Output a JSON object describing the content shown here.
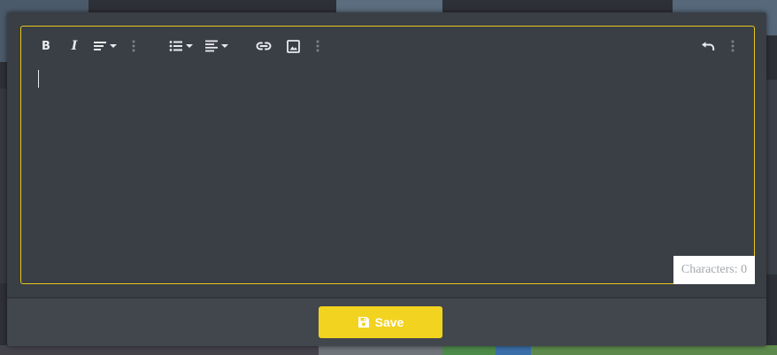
{
  "editor": {
    "toolbar": {
      "bold": {
        "label": "B",
        "icon": "bold-icon"
      },
      "italic": {
        "label": "I",
        "icon": "italic-icon"
      },
      "paragraph": {
        "icon": "text-format-icon"
      },
      "more_1": {
        "icon": "more-vertical-icon"
      },
      "list": {
        "icon": "bulleted-list-icon"
      },
      "align": {
        "icon": "align-left-icon"
      },
      "link": {
        "icon": "link-icon"
      },
      "image": {
        "icon": "image-icon"
      },
      "more_2": {
        "icon": "more-vertical-icon"
      },
      "undo": {
        "icon": "undo-icon"
      },
      "more_3": {
        "icon": "more-vertical-icon"
      }
    },
    "content": "",
    "counter_label": "Characters:",
    "counter_value": "0"
  },
  "footer": {
    "save_label": "Save",
    "save_icon": "floppy-disk-icon"
  },
  "colors": {
    "accent": "#f2d320",
    "focus_border": "#e8c81c",
    "panel_bg": "#3a3e45",
    "footer_bg": "#42464d",
    "icon_color": "#e8eaed"
  }
}
